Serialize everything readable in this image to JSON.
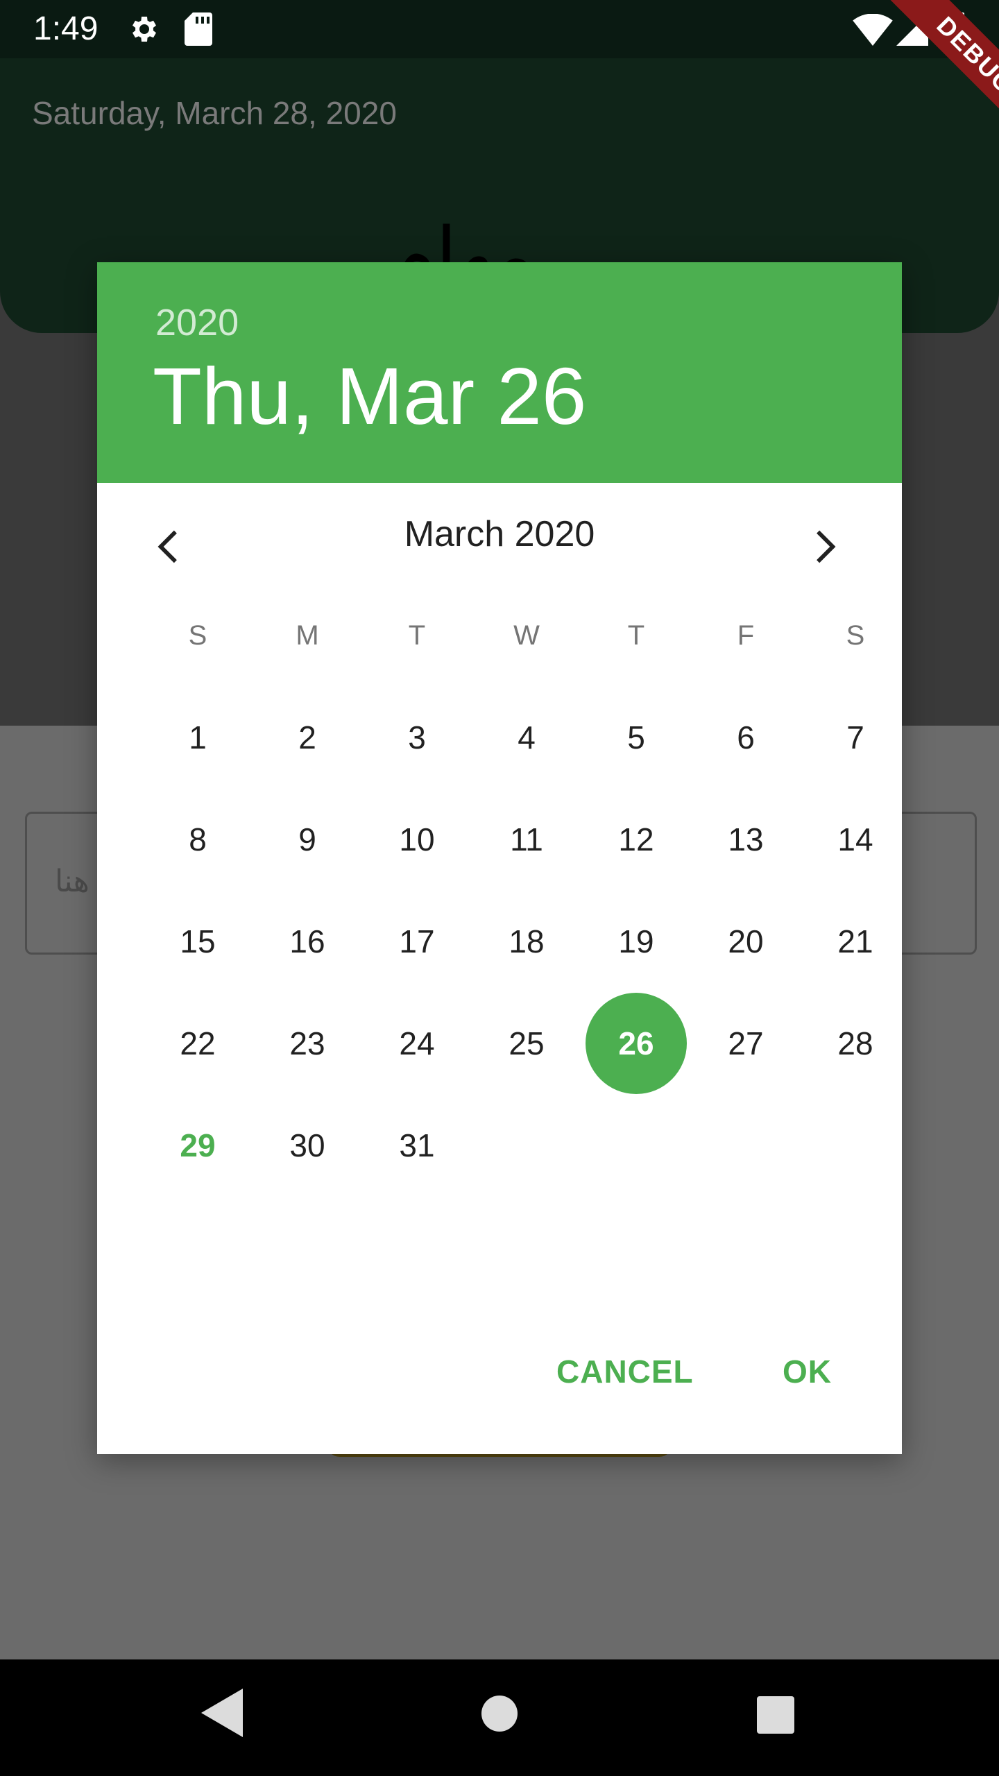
{
  "status_bar": {
    "time": "1:49",
    "icons": [
      "gear-icon",
      "sd-card-icon",
      "wifi-icon",
      "signal-icon",
      "battery-icon"
    ]
  },
  "background": {
    "date_text": "Saturday, March 28, 2020",
    "title_partial": "مهام",
    "input_hint": "هنا"
  },
  "debug_banner": "DEBUG",
  "date_picker": {
    "accent_color": "#4caf50",
    "header_year": "2020",
    "header_date": "Thu, Mar 26",
    "month_label": "March 2020",
    "weekdays": [
      "S",
      "M",
      "T",
      "W",
      "T",
      "F",
      "S"
    ],
    "days": [
      "1",
      "2",
      "3",
      "4",
      "5",
      "6",
      "7",
      "8",
      "9",
      "10",
      "11",
      "12",
      "13",
      "14",
      "15",
      "16",
      "17",
      "18",
      "19",
      "20",
      "21",
      "22",
      "23",
      "24",
      "25",
      "26",
      "27",
      "28",
      "29",
      "30",
      "31"
    ],
    "first_weekday_index": 0,
    "selected_day": "26",
    "today_day": "29",
    "cancel_label": "CANCEL",
    "ok_label": "OK"
  }
}
